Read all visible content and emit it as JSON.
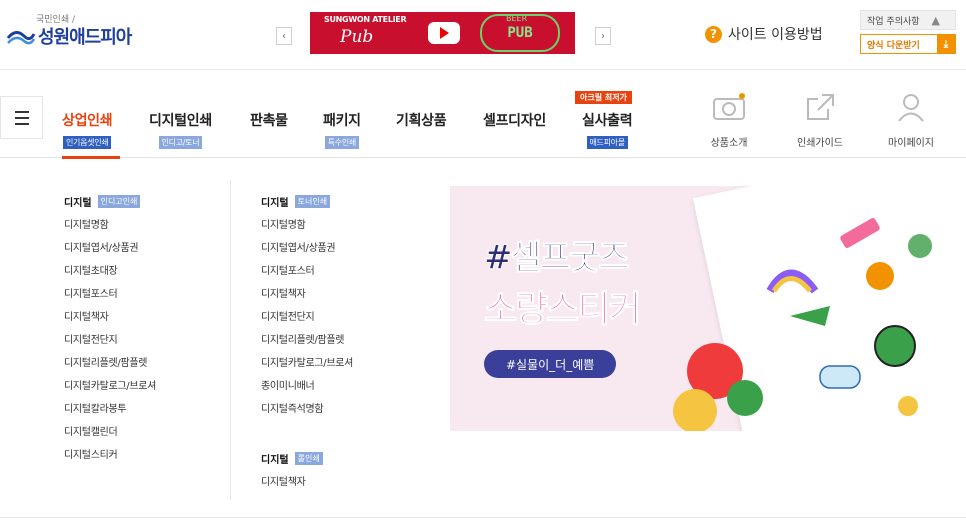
{
  "header": {
    "tagline": "국민인쇄 /",
    "brand_name": "성원애드피아",
    "banner": {
      "brand": "SUNGWON ATELIER",
      "script": "Pub",
      "neon": "PUB",
      "neon_small": "BEER"
    },
    "prev_arrow": "‹",
    "next_arrow": "›",
    "guide_icon": "?",
    "guide_label": "사이트 이용방법",
    "notice_label": "작업 주의사항",
    "notice_icon": "▲",
    "download_label": "양식 다운받기",
    "download_icon": "⤓"
  },
  "gnb": {
    "hot_tag": "아크릴 최저가",
    "items": [
      {
        "label": "상업인쇄",
        "sub": "인기옵셋인쇄"
      },
      {
        "label": "디지털인쇄",
        "sub": "인디고/토너"
      },
      {
        "label": "판촉물",
        "sub": ""
      },
      {
        "label": "패키지",
        "sub": "특수인쇄"
      },
      {
        "label": "기획상품",
        "sub": ""
      },
      {
        "label": "셀프디자인",
        "sub": ""
      },
      {
        "label": "실사출력",
        "sub": "애드피아몰"
      }
    ],
    "utils": [
      {
        "label": "상품소개",
        "icon": "camera-icon"
      },
      {
        "label": "인쇄가이드",
        "icon": "external-link-icon"
      },
      {
        "label": "마이페이지",
        "icon": "user-icon"
      }
    ]
  },
  "dropdown": {
    "col1": {
      "title": "디지털",
      "tag": "인디고인쇄",
      "items": [
        "디지털명함",
        "디지털엽서/상품권",
        "디지털초대장",
        "디지털포스터",
        "디지털책자",
        "디지털전단지",
        "디지털리플렛/팜플렛",
        "디지털카탈로그/브로셔",
        "디지털칼라봉투",
        "디지털캘린더",
        "디지털스티커"
      ]
    },
    "col2": {
      "title": "디지털",
      "tag": "토너인쇄",
      "items": [
        "디지털명함",
        "디지털엽서/상품권",
        "디지털포스터",
        "디지털책자",
        "디지털전단지",
        "디지털리플렛/팜플렛",
        "디지털카탈로그/브로셔",
        "종이미니배너",
        "디지털즉석명함"
      ]
    },
    "col3": {
      "title": "디지털",
      "tag": "롤인쇄",
      "items": [
        "디지털책자"
      ]
    },
    "promo": {
      "line1": "#셀프굿즈",
      "line2": "소량스티커",
      "pill": "#실물이_더_예쁨"
    }
  },
  "colors": {
    "brand_blue": "#1e3f9c",
    "accent_orange": "#e8420f",
    "tag_blue": "#2e5fc1",
    "tag_light_blue": "#8aa7de"
  }
}
